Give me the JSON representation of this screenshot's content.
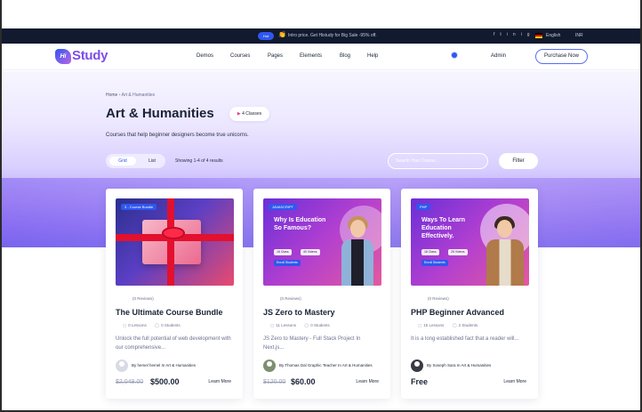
{
  "topbar": {
    "hot_label": "Hot",
    "emoji": "👏",
    "promo_text": "Intro price. Get Histudy for Big Sale -95% off.",
    "social_icons": [
      "f",
      "t",
      "in",
      "ig"
    ],
    "language": "English",
    "currency": "INR"
  },
  "header": {
    "logo_mark": "Hi",
    "logo_text": "Study",
    "nav": [
      "Demos",
      "Courses",
      "Pages",
      "Elements",
      "Blog",
      "Help"
    ],
    "admin_label": "Admin",
    "purchase_label": "Purchase Now"
  },
  "hero": {
    "breadcrumb_home": "Home",
    "breadcrumb_sep": "•",
    "breadcrumb_current": "Art & Humanities",
    "title": "Art & Humanities",
    "classes_icon": "▶",
    "classes_label": "4 Classes",
    "subtitle": "Courses that help beginner designers become true unicorns.",
    "grid_label": "Grid",
    "list_label": "List",
    "showing": "Showing 1-4 of 4 results",
    "search_placeholder": "Search Your Course...",
    "filter_label": "Filter"
  },
  "cards": [
    {
      "thumb_tag": "3 - Course Bundle",
      "reviews": "(0 Reviews)",
      "title": "The Ultimate Course Bundle",
      "lessons": "0 Lessons",
      "students": "0 Students",
      "desc": "Unlock the full potential of web development with our comprehensive...",
      "author": "By hemel hemel In Art & Humanities",
      "price_old": "$2,049.00",
      "price_new": "$500.00",
      "learn": "Learn More"
    },
    {
      "thumb_tag": "JAVASCRIPT",
      "thumb_headline": "Why Is Education So Famous?",
      "thumb_pill_1": "16 Class",
      "thumb_pill_2": "40 Videos",
      "thumb_cta": "Enroll Students",
      "reviews": "(0 Reviews)",
      "title": "JS Zero to Mastery",
      "lessons": "11 Lessons",
      "students": "0 Students",
      "desc": "JS Zero to Mastery - Full Stack Project In Next.js...",
      "author": "By Thomas Dal Graphic Teacher In Art & Humanities",
      "price_old": "$120.00",
      "price_new": "$60.00",
      "learn": "Learn More"
    },
    {
      "thumb_tag": "PHP",
      "thumb_headline": "Ways To Learn Education Effectively.",
      "thumb_pill_1": "18 Class",
      "thumb_pill_2": "25 Videos",
      "thumb_cta": "Enroll Students",
      "reviews": "(0 Reviews)",
      "title": "PHP Beginner Advanced",
      "lessons": "15 Lessons",
      "students": "2 Students",
      "desc": "It is a long established fact that a reader will...",
      "author": "By Soseph Sara In Art & Humanities",
      "price_new": "Free",
      "learn": "Learn More"
    }
  ],
  "colors": {
    "brand": "#2f57ef",
    "logo": "#7c4dea",
    "topbar_bg": "#111a2f",
    "title": "#192335"
  }
}
